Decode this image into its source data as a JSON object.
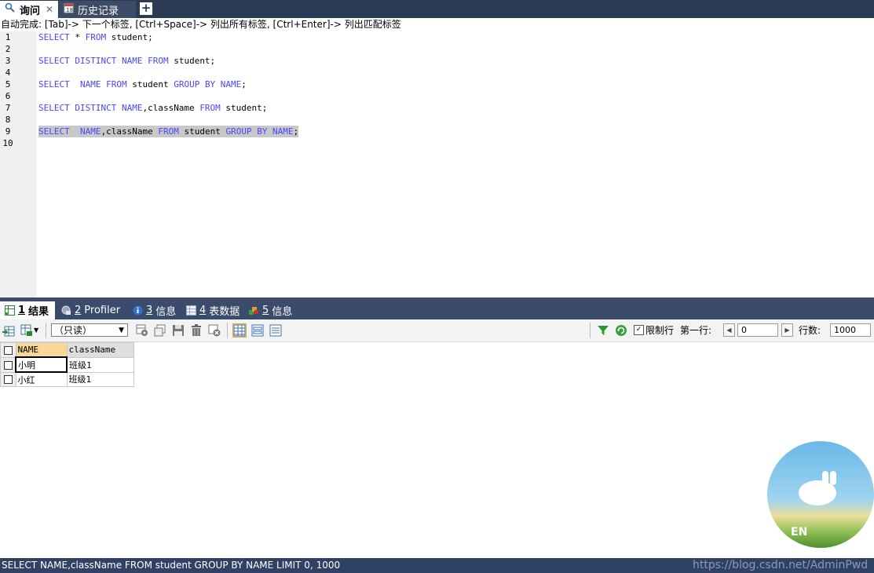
{
  "top_tabs": [
    {
      "label": "询问",
      "icon": "query-icon",
      "active": true
    },
    {
      "label": "历史记录",
      "icon": "history-icon",
      "active": false
    }
  ],
  "hint": "自动完成: [Tab]-> 下一个标签, [Ctrl+Space]-> 列出所有标签, [Ctrl+Enter]-> 列出匹配标签",
  "editor": {
    "line_numbers": [
      "1",
      "2",
      "3",
      "4",
      "5",
      "6",
      "7",
      "8",
      "9",
      "10"
    ],
    "lines": {
      "l1": {
        "kw1": "SELECT",
        "t1": " * ",
        "kw2": "FROM",
        "t2": " student;"
      },
      "l3": {
        "kw1": "SELECT DISTINCT NAME FROM",
        "t1": " student;"
      },
      "l5": {
        "kw1": "SELECT  NAME FROM",
        "t1": " student ",
        "kw2": "GROUP BY NAME",
        "t2": ";"
      },
      "l7": {
        "kw1": "SELECT DISTINCT NAME",
        "t1": ",className ",
        "kw2": "FROM",
        "t2": " student;"
      },
      "l9": {
        "kw1": "SELECT  NAME",
        "t1": ",className ",
        "kw2": "FROM",
        "t2": " student ",
        "kw3": "GROUP BY NAME",
        "t3": ";"
      }
    },
    "keyword_color": "#4646ff",
    "selection_color": "#c8c8c8"
  },
  "result_tabs": [
    {
      "num": "1",
      "label": "结果",
      "icon": "grid-result-icon",
      "active": true
    },
    {
      "num": "2",
      "label": "Profiler",
      "icon": "profiler-icon",
      "active": false
    },
    {
      "num": "3",
      "label": "信息",
      "icon": "info-icon",
      "active": false
    },
    {
      "num": "4",
      "label": "表数据",
      "icon": "table-data-icon",
      "active": false
    },
    {
      "num": "5",
      "label": "信息",
      "icon": "info-color-icon",
      "active": false
    }
  ],
  "toolbar": {
    "mode_select": "（只读）",
    "limit_label": "限制行",
    "limit_checked": true,
    "first_row_label": "第一行:",
    "first_row_value": "0",
    "row_count_label": "行数:",
    "row_count_value": "1000"
  },
  "grid": {
    "columns": [
      "NAME",
      "className"
    ],
    "rows": [
      [
        "小明",
        "班级1"
      ],
      [
        "小红",
        "班级1"
      ]
    ]
  },
  "avatar": {
    "badge": "EN"
  },
  "statusbar": "SELECT NAME,className FROM student GROUP BY NAME LIMIT 0, 1000",
  "watermark": "https://blog.csdn.net/AdminPwd"
}
